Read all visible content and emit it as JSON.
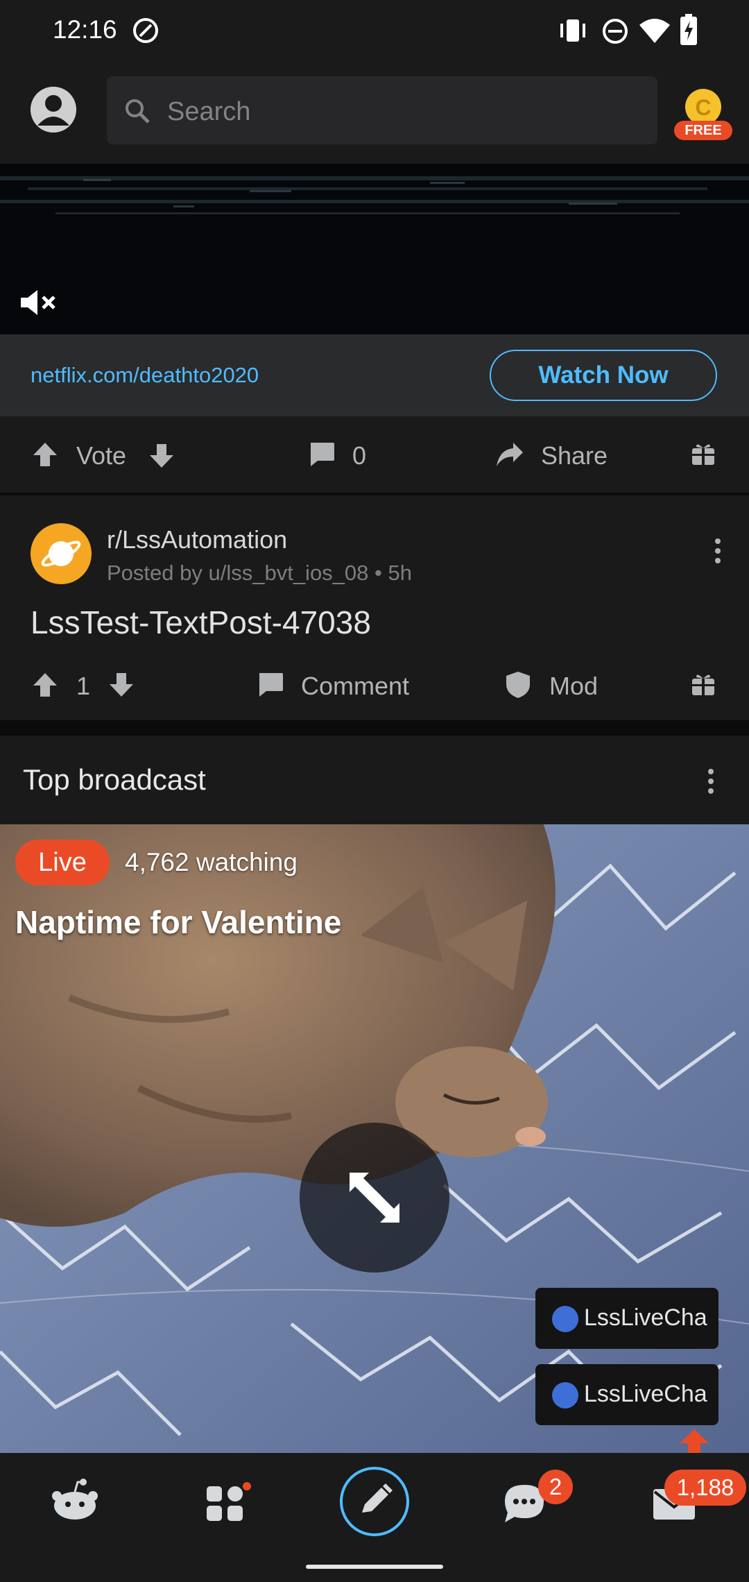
{
  "status_bar": {
    "time": "12:16",
    "icons": [
      "at-sign-icon",
      "vibrate-icon",
      "dnd-icon",
      "wifi-icon",
      "battery-charging-icon"
    ]
  },
  "header": {
    "search_placeholder": "Search",
    "coin_label": "FREE"
  },
  "ad": {
    "link": "netflix.com/deathto2020",
    "cta": "Watch Now",
    "actions": {
      "vote_label": "Vote",
      "comments": "0",
      "share_label": "Share"
    }
  },
  "post": {
    "subreddit": "r/LssAutomation",
    "meta": "Posted by u/lss_bvt_ios_08 • 5h",
    "title": "LssTest-TextPost-47038",
    "score": "1",
    "comment_label": "Comment",
    "mod_label": "Mod"
  },
  "broadcast": {
    "section_title": "Top broadcast",
    "live_label": "Live",
    "watching": "4,762 watching",
    "stream_title": "Naptime for Valentine",
    "chat_items": [
      "LssLiveCha",
      "LssLiveCha"
    ]
  },
  "bottom_nav": {
    "chat_badge": "2",
    "inbox_badge": "1,188"
  },
  "colors": {
    "accent_blue": "#4fbcff",
    "live_orange": "#ea4b26",
    "subreddit_icon": "#f5a623"
  }
}
